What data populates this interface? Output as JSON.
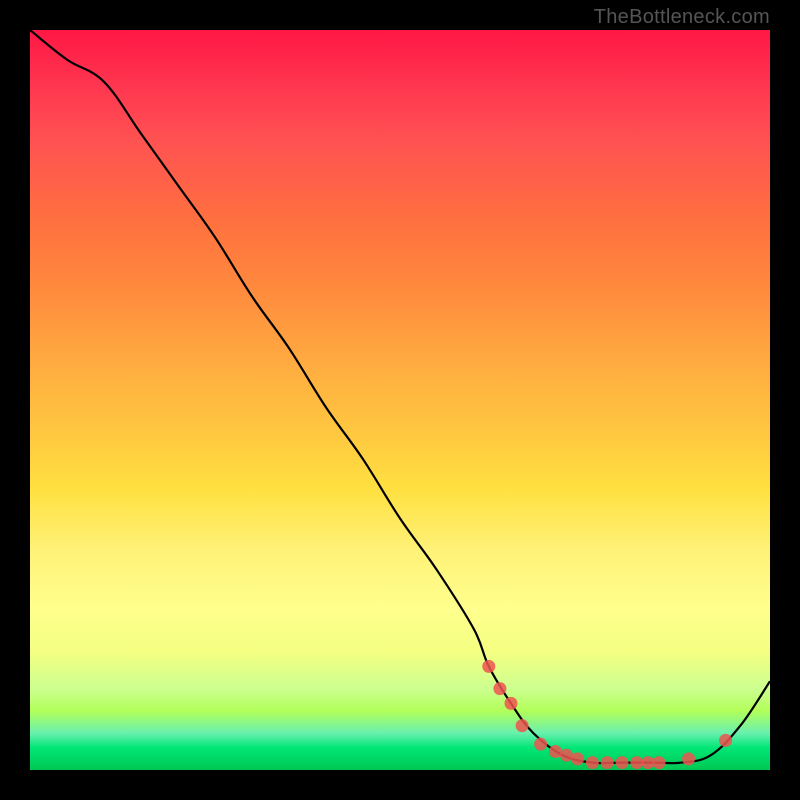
{
  "watermark": "TheBottleneck.com",
  "chart_data": {
    "type": "line",
    "title": "",
    "xlabel": "",
    "ylabel": "",
    "xlim": [
      0,
      100
    ],
    "ylim": [
      0,
      100
    ],
    "x": [
      0,
      5,
      10,
      15,
      20,
      25,
      30,
      35,
      40,
      45,
      50,
      55,
      60,
      62,
      65,
      68,
      72,
      76,
      80,
      84,
      88,
      92,
      96,
      100
    ],
    "values": [
      100,
      96,
      93,
      86,
      79,
      72,
      64,
      57,
      49,
      42,
      34,
      27,
      19,
      14,
      9,
      5,
      2,
      1,
      1,
      1,
      1,
      2,
      6,
      12
    ],
    "dots": [
      {
        "x": 62,
        "y": 14
      },
      {
        "x": 63.5,
        "y": 11
      },
      {
        "x": 65,
        "y": 9
      },
      {
        "x": 66.5,
        "y": 6
      },
      {
        "x": 69,
        "y": 3.5
      },
      {
        "x": 71,
        "y": 2.5
      },
      {
        "x": 72.5,
        "y": 2
      },
      {
        "x": 74,
        "y": 1.5
      },
      {
        "x": 76,
        "y": 1
      },
      {
        "x": 78,
        "y": 1
      },
      {
        "x": 80,
        "y": 1
      },
      {
        "x": 82,
        "y": 1
      },
      {
        "x": 83.5,
        "y": 1
      },
      {
        "x": 85,
        "y": 1
      },
      {
        "x": 89,
        "y": 1.5
      },
      {
        "x": 94,
        "y": 4
      }
    ]
  }
}
